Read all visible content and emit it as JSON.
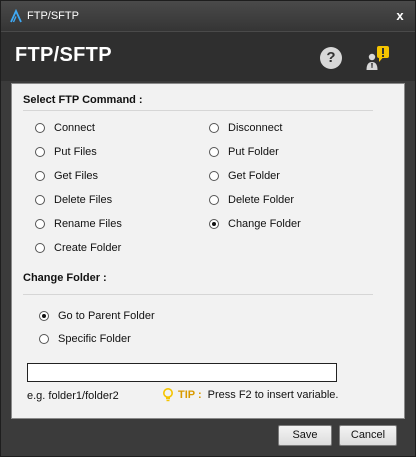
{
  "window": {
    "title": "FTP/SFTP",
    "close_symbol": "x"
  },
  "header": {
    "title": "FTP/SFTP",
    "help_symbol": "?"
  },
  "commands": {
    "heading": "Select FTP Command :",
    "left": [
      {
        "label": "Connect",
        "checked": false
      },
      {
        "label": "Put Files",
        "checked": false
      },
      {
        "label": "Get Files",
        "checked": false
      },
      {
        "label": "Delete Files",
        "checked": false
      },
      {
        "label": "Rename Files",
        "checked": false
      },
      {
        "label": "Create Folder",
        "checked": false
      }
    ],
    "right": [
      {
        "label": "Disconnect",
        "checked": false
      },
      {
        "label": "Put Folder",
        "checked": false
      },
      {
        "label": "Get Folder",
        "checked": false
      },
      {
        "label": "Delete Folder",
        "checked": false
      },
      {
        "label": "Change Folder",
        "checked": true
      }
    ]
  },
  "change_folder": {
    "heading": "Change Folder :",
    "options": [
      {
        "label": "Go to Parent Folder",
        "checked": true
      },
      {
        "label": "Specific Folder",
        "checked": false
      }
    ],
    "input_value": "",
    "example": "e.g. folder1/folder2",
    "tip_label": "TIP :",
    "tip_text": "Press F2 to insert variable."
  },
  "buttons": {
    "save": "Save",
    "cancel": "Cancel"
  },
  "colors": {
    "tip": "#d99a00",
    "badge": "#f5c400",
    "logo": "#3fa9f5"
  }
}
